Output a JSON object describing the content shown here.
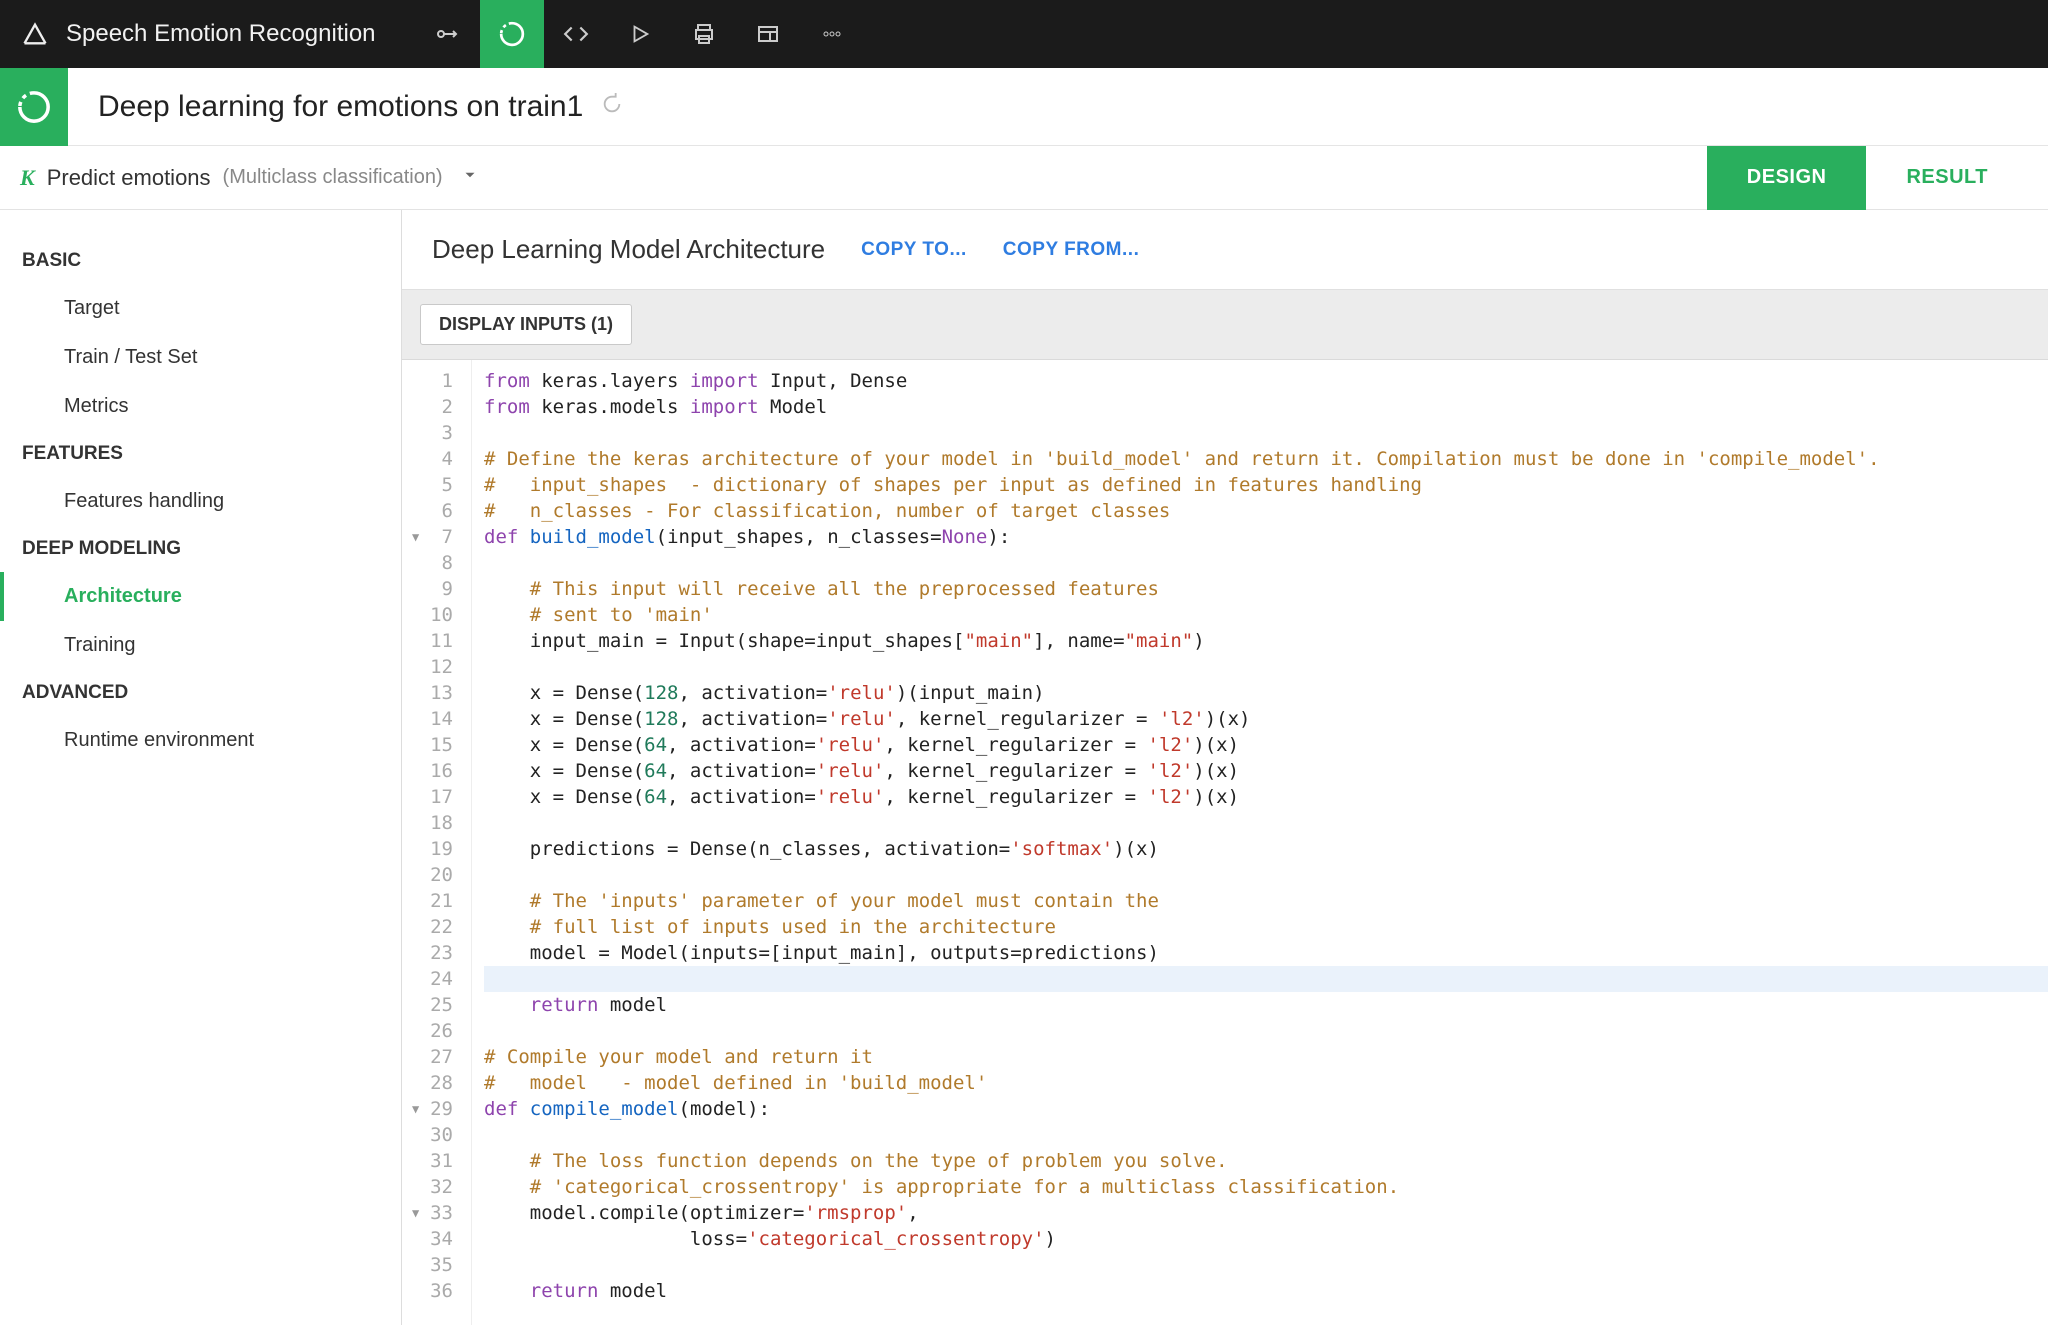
{
  "topbar": {
    "project": "Speech Emotion Recognition"
  },
  "titlerow": {
    "title": "Deep learning for emotions on train1"
  },
  "subheader": {
    "task": "Predict emotions",
    "task_subtype": "(Multiclass classification)",
    "tab_design": "DESIGN",
    "tab_result": "RESULT"
  },
  "sidebar": {
    "groups": [
      {
        "label": "BASIC",
        "items": [
          "Target",
          "Train / Test Set",
          "Metrics"
        ]
      },
      {
        "label": "FEATURES",
        "items": [
          "Features handling"
        ]
      },
      {
        "label": "DEEP MODELING",
        "items": [
          "Architecture",
          "Training"
        ],
        "active": "Architecture"
      },
      {
        "label": "ADVANCED",
        "items": [
          "Runtime environment"
        ]
      }
    ]
  },
  "panel": {
    "heading": "Deep Learning Model Architecture",
    "copy_to": "COPY TO...",
    "copy_from": "COPY FROM...",
    "display_inputs": "DISPLAY INPUTS (1)"
  },
  "editor": {
    "cursor_line": 24,
    "fold_markers": [
      7,
      29,
      33
    ],
    "lines": [
      {
        "n": 1,
        "t": [
          [
            "kw",
            "from"
          ],
          [
            "p",
            " keras.layers "
          ],
          [
            "kw",
            "import"
          ],
          [
            "p",
            " Input, Dense"
          ]
        ]
      },
      {
        "n": 2,
        "t": [
          [
            "kw",
            "from"
          ],
          [
            "p",
            " keras.models "
          ],
          [
            "kw",
            "import"
          ],
          [
            "p",
            " Model"
          ]
        ]
      },
      {
        "n": 3,
        "t": []
      },
      {
        "n": 4,
        "t": [
          [
            "cm",
            "# Define the keras architecture of your model in 'build_model' and return it. Compilation must be done in 'compile_model'."
          ]
        ]
      },
      {
        "n": 5,
        "t": [
          [
            "cm",
            "#   input_shapes  - dictionary of shapes per input as defined in features handling"
          ]
        ]
      },
      {
        "n": 6,
        "t": [
          [
            "cm",
            "#   n_classes - For classification, number of target classes"
          ]
        ]
      },
      {
        "n": 7,
        "t": [
          [
            "kw",
            "def"
          ],
          [
            "p",
            " "
          ],
          [
            "fn",
            "build_model"
          ],
          [
            "p",
            "(input_shapes, n_classes="
          ],
          [
            "none",
            "None"
          ],
          [
            "p",
            "):"
          ]
        ]
      },
      {
        "n": 8,
        "t": []
      },
      {
        "n": 9,
        "t": [
          [
            "p",
            "    "
          ],
          [
            "cm",
            "# This input will receive all the preprocessed features"
          ]
        ]
      },
      {
        "n": 10,
        "t": [
          [
            "p",
            "    "
          ],
          [
            "cm",
            "# sent to 'main'"
          ]
        ]
      },
      {
        "n": 11,
        "t": [
          [
            "p",
            "    input_main = Input(shape=input_shapes["
          ],
          [
            "str",
            "\"main\""
          ],
          [
            "p",
            "], name="
          ],
          [
            "str",
            "\"main\""
          ],
          [
            "p",
            ")"
          ]
        ]
      },
      {
        "n": 12,
        "t": []
      },
      {
        "n": 13,
        "t": [
          [
            "p",
            "    x = Dense("
          ],
          [
            "num",
            "128"
          ],
          [
            "p",
            ", activation="
          ],
          [
            "str",
            "'relu'"
          ],
          [
            "p",
            ")(input_main)"
          ]
        ]
      },
      {
        "n": 14,
        "t": [
          [
            "p",
            "    x = Dense("
          ],
          [
            "num",
            "128"
          ],
          [
            "p",
            ", activation="
          ],
          [
            "str",
            "'relu'"
          ],
          [
            "p",
            ", kernel_regularizer = "
          ],
          [
            "str",
            "'l2'"
          ],
          [
            "p",
            ")(x)"
          ]
        ]
      },
      {
        "n": 15,
        "t": [
          [
            "p",
            "    x = Dense("
          ],
          [
            "num",
            "64"
          ],
          [
            "p",
            ", activation="
          ],
          [
            "str",
            "'relu'"
          ],
          [
            "p",
            ", kernel_regularizer = "
          ],
          [
            "str",
            "'l2'"
          ],
          [
            "p",
            ")(x)"
          ]
        ]
      },
      {
        "n": 16,
        "t": [
          [
            "p",
            "    x = Dense("
          ],
          [
            "num",
            "64"
          ],
          [
            "p",
            ", activation="
          ],
          [
            "str",
            "'relu'"
          ],
          [
            "p",
            ", kernel_regularizer = "
          ],
          [
            "str",
            "'l2'"
          ],
          [
            "p",
            ")(x)"
          ]
        ]
      },
      {
        "n": 17,
        "t": [
          [
            "p",
            "    x = Dense("
          ],
          [
            "num",
            "64"
          ],
          [
            "p",
            ", activation="
          ],
          [
            "str",
            "'relu'"
          ],
          [
            "p",
            ", kernel_regularizer = "
          ],
          [
            "str",
            "'l2'"
          ],
          [
            "p",
            ")(x)"
          ]
        ]
      },
      {
        "n": 18,
        "t": []
      },
      {
        "n": 19,
        "t": [
          [
            "p",
            "    predictions = Dense(n_classes, activation="
          ],
          [
            "str",
            "'softmax'"
          ],
          [
            "p",
            ")(x)"
          ]
        ]
      },
      {
        "n": 20,
        "t": []
      },
      {
        "n": 21,
        "t": [
          [
            "p",
            "    "
          ],
          [
            "cm",
            "# The 'inputs' parameter of your model must contain the"
          ]
        ]
      },
      {
        "n": 22,
        "t": [
          [
            "p",
            "    "
          ],
          [
            "cm",
            "# full list of inputs used in the architecture"
          ]
        ]
      },
      {
        "n": 23,
        "t": [
          [
            "p",
            "    model = Model(inputs=[input_main], outputs=predictions)"
          ]
        ]
      },
      {
        "n": 24,
        "t": []
      },
      {
        "n": 25,
        "t": [
          [
            "p",
            "    "
          ],
          [
            "kw",
            "return"
          ],
          [
            "p",
            " model"
          ]
        ]
      },
      {
        "n": 26,
        "t": []
      },
      {
        "n": 27,
        "t": [
          [
            "cm",
            "# Compile your model and return it"
          ]
        ]
      },
      {
        "n": 28,
        "t": [
          [
            "cm",
            "#   model   - model defined in 'build_model'"
          ]
        ]
      },
      {
        "n": 29,
        "t": [
          [
            "kw",
            "def"
          ],
          [
            "p",
            " "
          ],
          [
            "fn",
            "compile_model"
          ],
          [
            "p",
            "(model):"
          ]
        ]
      },
      {
        "n": 30,
        "t": []
      },
      {
        "n": 31,
        "t": [
          [
            "p",
            "    "
          ],
          [
            "cm",
            "# The loss function depends on the type of problem you solve."
          ]
        ]
      },
      {
        "n": 32,
        "t": [
          [
            "p",
            "    "
          ],
          [
            "cm",
            "# 'categorical_crossentropy' is appropriate for a multiclass classification."
          ]
        ]
      },
      {
        "n": 33,
        "t": [
          [
            "p",
            "    model.compile(optimizer="
          ],
          [
            "str",
            "'rmsprop'"
          ],
          [
            "p",
            ","
          ]
        ]
      },
      {
        "n": 34,
        "t": [
          [
            "p",
            "                  loss="
          ],
          [
            "str",
            "'categorical_crossentropy'"
          ],
          [
            "p",
            ")"
          ]
        ]
      },
      {
        "n": 35,
        "t": []
      },
      {
        "n": 36,
        "t": [
          [
            "p",
            "    "
          ],
          [
            "kw",
            "return"
          ],
          [
            "p",
            " model"
          ]
        ]
      }
    ]
  }
}
